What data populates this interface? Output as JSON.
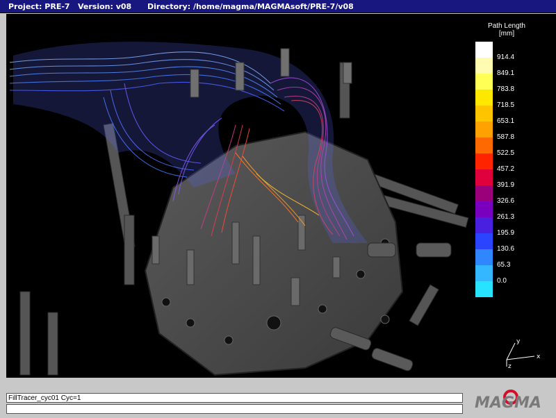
{
  "titlebar": {
    "project": "Project: PRE-7",
    "version": "Version: v08",
    "directory": "Directory: /home/magma/MAGMAsoft/PRE-7/v08"
  },
  "legend": {
    "title_line1": "Path Length",
    "title_line2": "[mm]",
    "ticks": [
      "914.4",
      "849.1",
      "783.8",
      "718.5",
      "653.1",
      "587.8",
      "522.5",
      "457.2",
      "391.9",
      "326.6",
      "261.3",
      "195.9",
      "130.6",
      "65.3",
      "0.0"
    ],
    "colors": [
      "#ffffff",
      "#fffbb0",
      "#ffff55",
      "#ffe800",
      "#ffc400",
      "#ffa100",
      "#ff6a00",
      "#ff2400",
      "#e0003c",
      "#9a007a",
      "#7a00c0",
      "#4a20e0",
      "#2b44ff",
      "#2f86ff",
      "#35b7ff",
      "#28e3ff"
    ]
  },
  "axes": {
    "x": "x",
    "y": "y",
    "z": "z"
  },
  "status": {
    "line1": "FillTracer_cyc01 Cyc=1"
  },
  "logo": {
    "text": "MAGMA"
  }
}
